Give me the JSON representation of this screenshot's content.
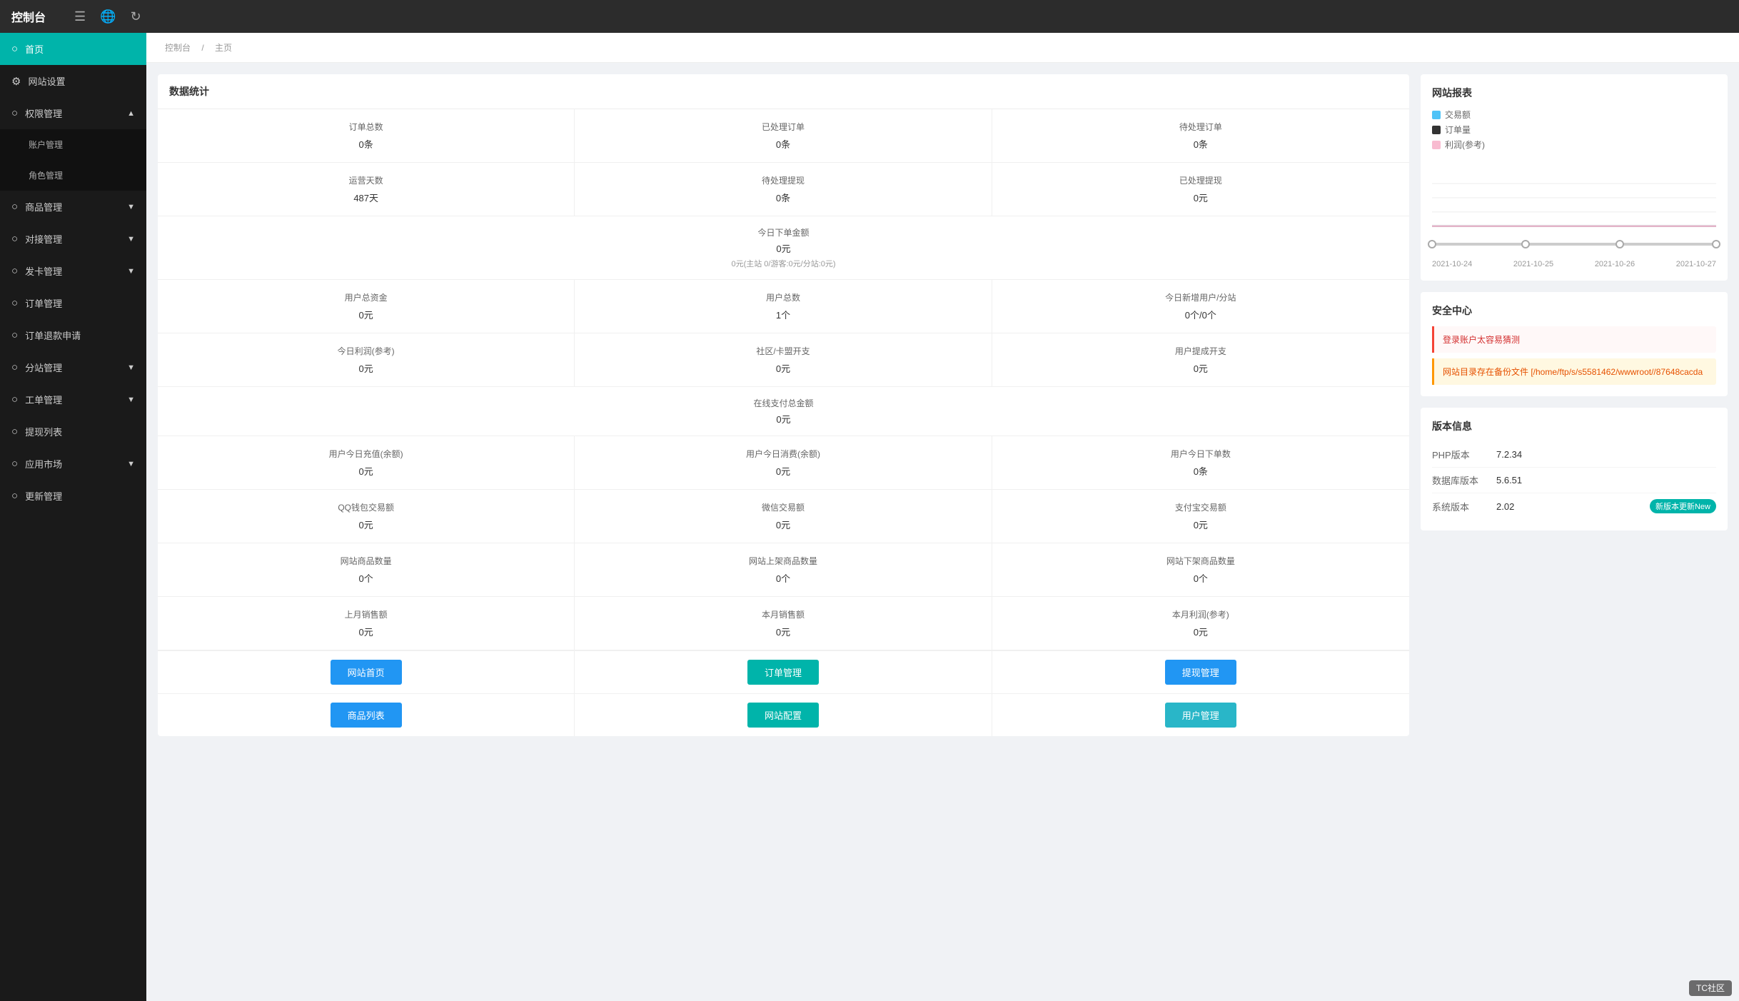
{
  "topbar": {
    "title": "控制台",
    "icons": [
      "menu-icon",
      "globe-icon",
      "refresh-icon"
    ]
  },
  "breadcrumb": {
    "items": [
      "控制台",
      "主页"
    ]
  },
  "sidebar": {
    "items": [
      {
        "id": "home",
        "label": "首页",
        "icon": "○",
        "active": true
      },
      {
        "id": "site-settings",
        "label": "网站设置",
        "icon": "⚙"
      },
      {
        "id": "permission",
        "label": "权限管理",
        "icon": "○",
        "hasArrow": true,
        "expanded": true
      },
      {
        "id": "account",
        "label": "账户管理",
        "sub": true
      },
      {
        "id": "role",
        "label": "角色管理",
        "sub": true
      },
      {
        "id": "goods",
        "label": "商品管理",
        "icon": "○",
        "hasArrow": true
      },
      {
        "id": "connect",
        "label": "对接管理",
        "icon": "○",
        "hasArrow": true
      },
      {
        "id": "card",
        "label": "发卡管理",
        "icon": "○",
        "hasArrow": true
      },
      {
        "id": "order",
        "label": "订单管理",
        "icon": "○"
      },
      {
        "id": "refund",
        "label": "订单退款申请",
        "icon": "○"
      },
      {
        "id": "branch",
        "label": "分站管理",
        "icon": "○",
        "hasArrow": true
      },
      {
        "id": "workorder",
        "label": "工单管理",
        "icon": "○",
        "hasArrow": true
      },
      {
        "id": "withdraw",
        "label": "提现列表",
        "icon": "○"
      },
      {
        "id": "appmarket",
        "label": "应用市场",
        "icon": "○",
        "hasArrow": true
      },
      {
        "id": "update",
        "label": "更新管理",
        "icon": "○"
      }
    ]
  },
  "stats": {
    "title": "数据统计",
    "cells": [
      {
        "label": "订单总数",
        "value": "0条"
      },
      {
        "label": "已处理订单",
        "value": "0条"
      },
      {
        "label": "待处理订单",
        "value": "0条"
      },
      {
        "label": "运营天数",
        "value": "487天"
      },
      {
        "label": "待处理提现",
        "value": "0条"
      },
      {
        "label": "已处理提现",
        "value": "0元"
      }
    ],
    "fullCell": {
      "label": "今日下单金额",
      "value": "0元",
      "sub": "0元(主站 0/游客:0元/分站:0元)"
    },
    "cells2": [
      {
        "label": "用户总资金",
        "value": "0元"
      },
      {
        "label": "用户总数",
        "value": "1个"
      },
      {
        "label": "今日新增用户/分站",
        "value": "0个/0个"
      },
      {
        "label": "今日利润(参考)",
        "value": "0元"
      },
      {
        "label": "社区/卡盟开支",
        "value": "0元"
      },
      {
        "label": "用户提成开支",
        "value": "0元"
      }
    ],
    "fullCell2": {
      "label": "在线支付总金额",
      "value": "0元"
    },
    "cells3": [
      {
        "label": "用户今日充值(余额)",
        "value": "0元"
      },
      {
        "label": "用户今日消费(余额)",
        "value": "0元"
      },
      {
        "label": "用户今日下单数",
        "value": "0条"
      },
      {
        "label": "QQ钱包交易额",
        "value": "0元"
      },
      {
        "label": "微信交易额",
        "value": "0元"
      },
      {
        "label": "支付宝交易额",
        "value": "0元"
      },
      {
        "label": "网站商品数量",
        "value": "0个"
      },
      {
        "label": "网站上架商品数量",
        "value": "0个"
      },
      {
        "label": "网站下架商品数量",
        "value": "0个"
      },
      {
        "label": "上月销售额",
        "value": "0元"
      },
      {
        "label": "本月销售额",
        "value": "0元"
      },
      {
        "label": "本月利润(参考)",
        "value": "0元"
      }
    ],
    "buttons_row1": [
      {
        "label": "网站首页",
        "color": "blue"
      },
      {
        "label": "订单管理",
        "color": "teal"
      },
      {
        "label": "提现管理",
        "color": "blue"
      }
    ],
    "buttons_row2": [
      {
        "label": "商品列表",
        "color": "blue"
      },
      {
        "label": "网站配置",
        "color": "teal"
      },
      {
        "label": "用户管理",
        "color": "cyan"
      }
    ]
  },
  "chart": {
    "title": "网站报表",
    "legend": [
      {
        "label": "交易额",
        "color": "#4fc3f7"
      },
      {
        "label": "订单量",
        "color": "#333333"
      },
      {
        "label": "利润(参考)",
        "color": "#f8bbd0"
      }
    ],
    "dates": [
      "2021-10-24",
      "2021-10-25",
      "2021-10-26",
      "2021-10-27"
    ],
    "sliderPositions": [
      0,
      33,
      66,
      100
    ]
  },
  "security": {
    "title": "安全中心",
    "items": [
      {
        "text": "登录账户太容易猜测",
        "type": "danger"
      },
      {
        "text": "网站目录存在备份文件 [/home/ftp/s/s5581462/wwwroot//87648cacda",
        "type": "warning"
      }
    ]
  },
  "version": {
    "title": "版本信息",
    "rows": [
      {
        "key": "PHP版本",
        "value": "7.2.34"
      },
      {
        "key": "数据库版本",
        "value": "5.6.51"
      },
      {
        "key": "系统版本",
        "value": "2.02",
        "badge": "新版本更新New"
      }
    ]
  },
  "watermark": {
    "text": "TC社区"
  }
}
